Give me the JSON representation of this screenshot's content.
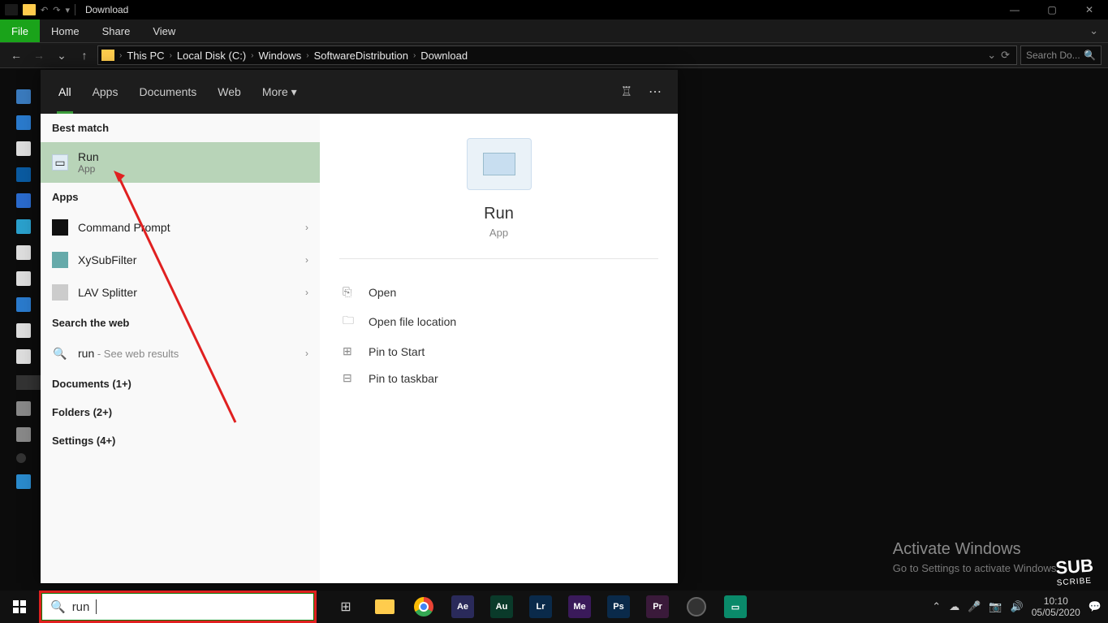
{
  "titlebar": {
    "title": "Download"
  },
  "ribbon": {
    "file": "File",
    "home": "Home",
    "share": "Share",
    "view": "View"
  },
  "breadcrumbs": [
    "This PC",
    "Local Disk (C:)",
    "Windows",
    "SoftwareDistribution",
    "Download"
  ],
  "explorer_search_placeholder": "Search Do...",
  "search_tabs": {
    "all": "All",
    "apps": "Apps",
    "documents": "Documents",
    "web": "Web",
    "more": "More"
  },
  "left": {
    "best_match_hdr": "Best match",
    "best_match": {
      "title": "Run",
      "subtitle": "App"
    },
    "apps_hdr": "Apps",
    "apps": [
      {
        "title": "Command Prompt"
      },
      {
        "title": "XySubFilter"
      },
      {
        "title": "LAV Splitter"
      }
    ],
    "web_hdr": "Search the web",
    "web": {
      "q": "run",
      "suffix": " - See web results"
    },
    "documents_hdr": "Documents (1+)",
    "folders_hdr": "Folders (2+)",
    "settings_hdr": "Settings (4+)"
  },
  "right": {
    "title": "Run",
    "subtitle": "App",
    "actions": [
      "Open",
      "Open file location",
      "Pin to Start",
      "Pin to taskbar"
    ]
  },
  "taskbar": {
    "search_value": "run",
    "apps": [
      {
        "label": "Ae",
        "bg": "#2a2a5a"
      },
      {
        "label": "Au",
        "bg": "#0a3a2a"
      },
      {
        "label": "Lr",
        "bg": "#0a2a4a"
      },
      {
        "label": "Me",
        "bg": "#3a1a5a"
      },
      {
        "label": "Ps",
        "bg": "#0a2a4a"
      },
      {
        "label": "Pr",
        "bg": "#3a1a3a"
      }
    ]
  },
  "tray": {
    "time": "10:10",
    "date": "05/05/2020"
  },
  "watermark": {
    "line1": "Activate Windows",
    "line2": "Go to Settings to activate Windows."
  },
  "subscribe": {
    "big": "SUB",
    "small": "SCRIBE"
  }
}
